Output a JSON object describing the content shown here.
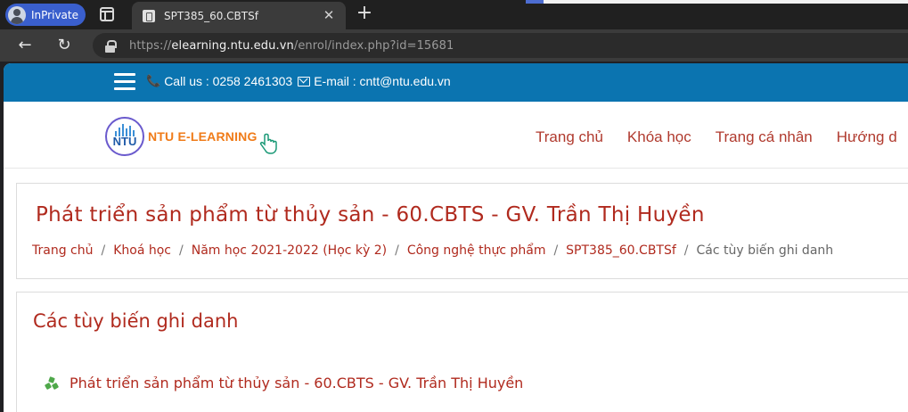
{
  "browser": {
    "inprivate_label": "InPrivate",
    "tab_title": "SPT385_60.CBTSf",
    "url_prefix": "https://",
    "url_host": "elearning.ntu.edu.vn",
    "url_path": "/enrol/index.php?id=15681",
    "colors": {
      "inprivate": "#3a5fcd",
      "chrome": "#3b3b3b"
    }
  },
  "topbar": {
    "phone": "Call us : 0258 2461303",
    "email": "E-mail : cntt@ntu.edu.vn",
    "color": "#0b74b0"
  },
  "header": {
    "logo_text": "NTU",
    "brand": "NTU E-LEARNING",
    "nav": [
      "Trang chủ",
      "Khóa học",
      "Trang cá nhân",
      "Hướng d"
    ]
  },
  "course": {
    "title": "Phát triển sản phẩm từ thủy sản - 60.CBTS - GV. Trần Thị Huyền",
    "breadcrumb": [
      "Trang chủ",
      "Khoá học",
      "Năm học 2021-2022 (Học kỳ 2)",
      "Công nghệ thực phẩm",
      "SPT385_60.CBTSf"
    ],
    "breadcrumb_current": "Các tùy biến ghi danh"
  },
  "enrol": {
    "section_title": "Các tùy biến ghi danh",
    "item": "Phát triển sản phẩm từ thủy sản - 60.CBTS - GV. Trần Thị Huyền",
    "accent": "#b02a1e"
  }
}
